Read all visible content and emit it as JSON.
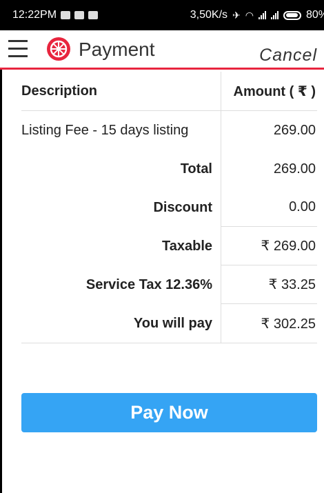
{
  "status_bar": {
    "time": "12:22PM",
    "network_speed": "3,50K/s",
    "battery": "80%"
  },
  "app_bar": {
    "title": "Payment",
    "cancel_label": "Cancel"
  },
  "table": {
    "headers": {
      "description": "Description",
      "amount": "Amount ( ₹ )"
    },
    "rows": [
      {
        "label": "Listing Fee - 15 days listing",
        "value": "269.00"
      },
      {
        "label": "Total",
        "value": "269.00"
      },
      {
        "label": "Discount",
        "value": "0.00"
      },
      {
        "label": "Taxable",
        "value": "₹ 269.00"
      },
      {
        "label": "Service Tax 12.36%",
        "value": "₹ 33.25"
      },
      {
        "label": "You will pay",
        "value": "₹ 302.25"
      }
    ]
  },
  "pay_button": {
    "label": "Pay Now"
  },
  "colors": {
    "accent_red": "#e8253e",
    "button_blue": "#35a4f4"
  }
}
